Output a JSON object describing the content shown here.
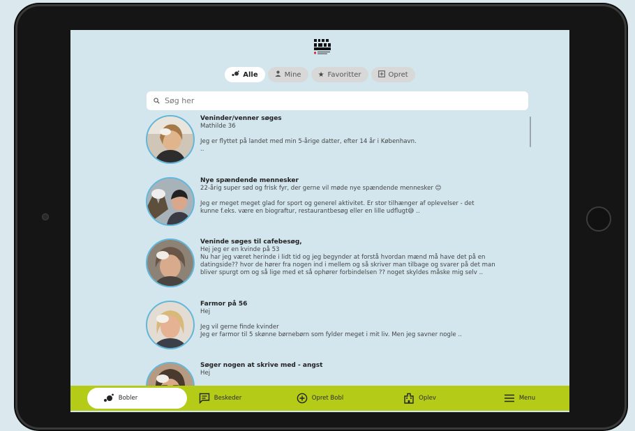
{
  "filters": [
    {
      "label": "Alle",
      "icon": "bubbles-icon",
      "active": true
    },
    {
      "label": "Mine",
      "icon": "person-icon",
      "active": false
    },
    {
      "label": "Favoritter",
      "icon": "star-icon",
      "active": false
    },
    {
      "label": "Opret",
      "icon": "plus-square-icon",
      "active": false
    }
  ],
  "search": {
    "placeholder": "Søg her"
  },
  "posts": [
    {
      "title": "Veninder/venner søges",
      "subtitle": "Mathilde 36",
      "body1": "Jeg er flyttet på landet med min 5-årige datter, efter 14 år i København.",
      "body2": ".."
    },
    {
      "title": "Nye spændende mennesker",
      "subtitle": "22-årig super sød og frisk fyr, der gerne vil møde nye spændende mennesker 😊",
      "body1": "Jeg er meget meget glad for sport og generel aktivitet. Er stor tilhænger af oplevelser - det",
      "body2": "kunne f.eks. være en biograftur, restaurantbesøg eller en lille udflugt😅 .."
    },
    {
      "title": "Veninde søges til cafebesøg,",
      "subtitle": "Hej jeg er en kvinde på 53",
      "body1": "Nu har jeg været herinde i lidt tid og jeg begynder at forstå hvordan mænd må have det på en",
      "body2": "datingside?? hvor de hører fra nogen ind i mellem og så skriver man tilbage og svarer på det man",
      "body3": "bliver spurgt om og så lige med et så ophører forbindelsen ?? noget skyldes måske mig selv .."
    },
    {
      "title": "Farmor på 56",
      "subtitle": "Hej",
      "body1": "Jeg vil gerne finde kvinder",
      "body2": "Jeg er farmor til 5 skønne børnebørn som fylder meget i mit liv. Men jeg savner nogle .."
    },
    {
      "title": "Søger nogen at skrive med - angst",
      "subtitle": "Hej"
    }
  ],
  "tabs": [
    {
      "label": "Bobler",
      "icon": "bubbles-icon"
    },
    {
      "label": "Beskeder",
      "icon": "message-icon"
    },
    {
      "label": "Opret Bobl",
      "icon": "plus-circle-icon"
    },
    {
      "label": "Oplev",
      "icon": "building-icon"
    },
    {
      "label": "Menu",
      "icon": "hamburger-icon"
    }
  ],
  "colors": {
    "screen_bg": "#d3e6ee",
    "tabbar": "#b4cc18",
    "avatar_ring": "#5fb7dd"
  }
}
